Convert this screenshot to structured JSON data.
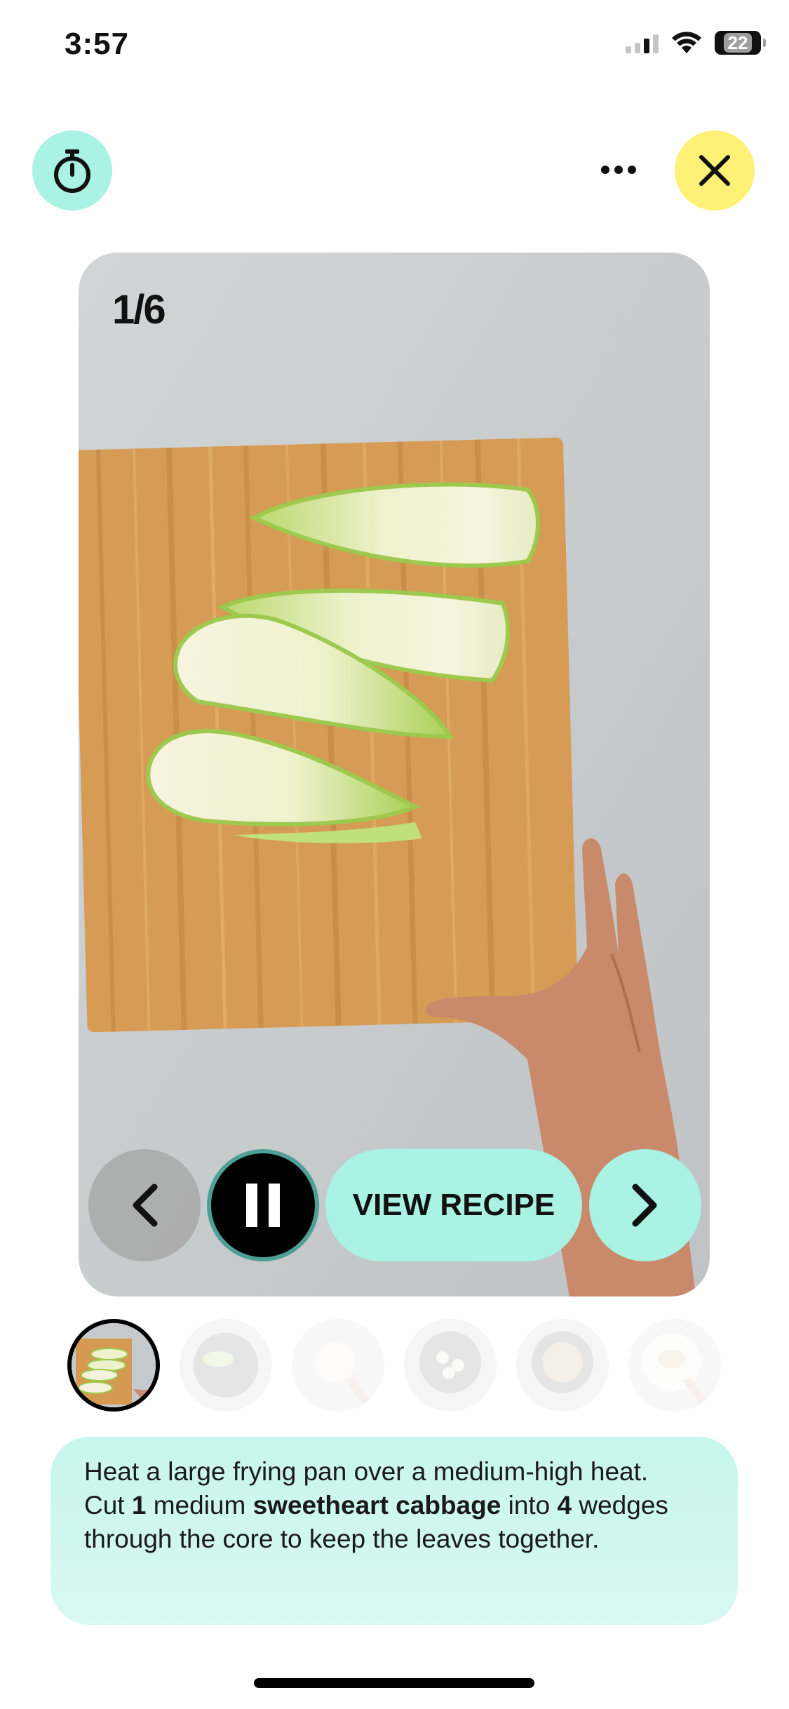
{
  "status_bar": {
    "time": "3:57",
    "battery": "22"
  },
  "top_bar": {
    "timer_icon": "stopwatch-icon",
    "more_icon": "ellipsis-icon",
    "close_icon": "close-icon",
    "close_color": "#fff176",
    "timer_color": "#a9f2e4"
  },
  "step": {
    "counter": "1/6",
    "photo_description_icon": "cabbage-wedges-on-cutting-board"
  },
  "controls": {
    "prev_icon": "chevron-left-icon",
    "pause_icon": "pause-icon",
    "view_recipe_label": "VIEW RECIPE",
    "next_icon": "chevron-right-icon"
  },
  "thumbnails": [
    {
      "name": "step-1",
      "active": true
    },
    {
      "name": "step-2",
      "active": false
    },
    {
      "name": "step-3",
      "active": false
    },
    {
      "name": "step-4",
      "active": false
    },
    {
      "name": "step-5",
      "active": false
    },
    {
      "name": "step-6",
      "active": false
    }
  ],
  "instruction": {
    "line1": "Heat a large frying pan over a medium-high heat.",
    "part_cut": "Cut ",
    "qty1": "1",
    "part_medium": " medium ",
    "ingredient": "sweetheart cabbage",
    "part_into": " into ",
    "qty2": "4",
    "part_wedges": " wedges",
    "line3": "through the core to keep the leaves together."
  },
  "colors": {
    "accent_mint": "#a9f2e4",
    "accent_yellow": "#fff176",
    "card_mint": "#c7f6ec"
  }
}
